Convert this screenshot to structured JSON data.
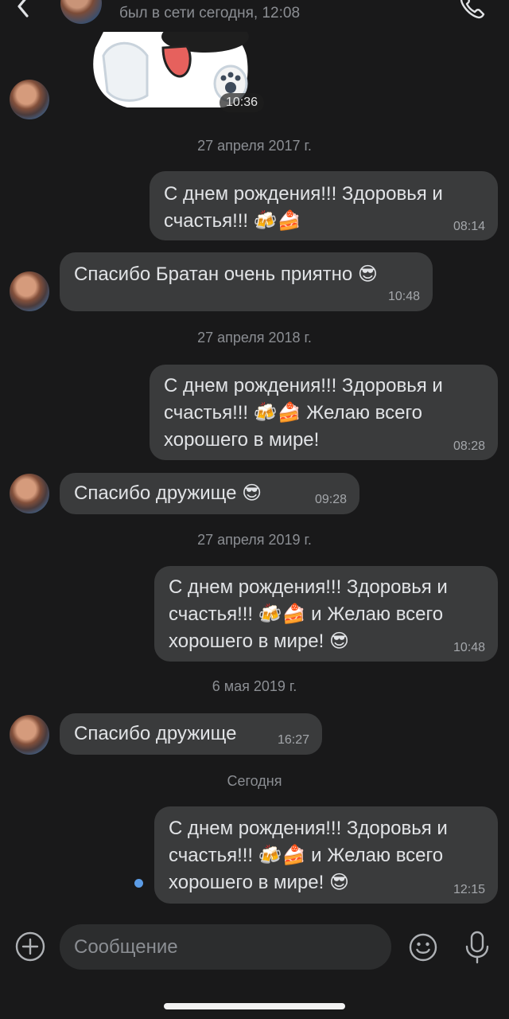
{
  "header": {
    "status": "был в сети сегодня, 12:08"
  },
  "sticker": {
    "time": "10:36"
  },
  "messages": [
    {
      "direction": "date",
      "text": "27 апреля 2017 г."
    },
    {
      "direction": "out",
      "text": "С днем рождения!!!  Здоровья и\nсчастья!!! 🍻🍰",
      "time": "08:14"
    },
    {
      "direction": "in",
      "text": "Спасибо Братан очень приятно 😎",
      "time": "10:48"
    },
    {
      "direction": "date",
      "text": "27 апреля 2018 г."
    },
    {
      "direction": "out",
      "text": "С днем рождения!!!  Здоровья и\nсчастья!!! 🍻🍰 Желаю всего\nхорошего в мире!",
      "time": "08:28"
    },
    {
      "direction": "in",
      "text": "Спасибо дружище 😎",
      "time": "09:28"
    },
    {
      "direction": "date",
      "text": "27 апреля 2019 г."
    },
    {
      "direction": "out",
      "text": "С днем рождения!!! Здоровья и\nсчастья!!! 🍻🍰 и Желаю всего\nхорошего в мире! 😎",
      "time": "10:48"
    },
    {
      "direction": "date",
      "text": "6 мая 2019 г."
    },
    {
      "direction": "in",
      "text": "Спасибо дружище",
      "time": "16:27"
    },
    {
      "direction": "date",
      "text": "Сегодня"
    },
    {
      "direction": "out",
      "text": "С днем рождения!!! Здоровья и\nсчастья!!! 🍻🍰 и Желаю всего\nхорошего в мире! 😎",
      "time": "12:15"
    }
  ],
  "composer": {
    "placeholder": "Сообщение"
  },
  "colors": {
    "background": "#19191a",
    "bubble": "#3a3b3c",
    "unread_dot": "#5c9ce6"
  },
  "icons": {
    "back": "chevron-left-icon",
    "call": "phone-icon",
    "add": "plus-circle-icon",
    "emoji": "smile-icon",
    "mic": "microphone-icon"
  }
}
